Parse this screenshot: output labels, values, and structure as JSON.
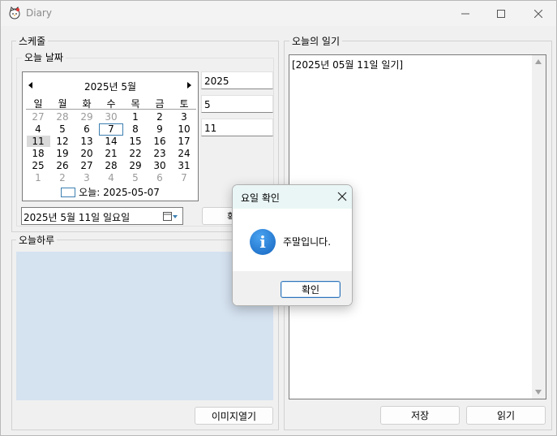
{
  "window": {
    "title": "Diary",
    "icon": "hello-kitty-app-icon"
  },
  "schedule": {
    "group_label": "스케줄",
    "today_date_label": "오늘 날짜",
    "calendar": {
      "month_title": "2025년 5월",
      "weekdays": [
        "일",
        "월",
        "화",
        "수",
        "목",
        "금",
        "토"
      ],
      "days": [
        {
          "d": "27",
          "other": true
        },
        {
          "d": "28",
          "other": true
        },
        {
          "d": "29",
          "other": true
        },
        {
          "d": "30",
          "other": true
        },
        {
          "d": "1"
        },
        {
          "d": "2"
        },
        {
          "d": "3"
        },
        {
          "d": "4"
        },
        {
          "d": "5"
        },
        {
          "d": "6"
        },
        {
          "d": "7",
          "today": true
        },
        {
          "d": "8"
        },
        {
          "d": "9"
        },
        {
          "d": "10"
        },
        {
          "d": "11",
          "selected": true
        },
        {
          "d": "12"
        },
        {
          "d": "13"
        },
        {
          "d": "14"
        },
        {
          "d": "15"
        },
        {
          "d": "16"
        },
        {
          "d": "17"
        },
        {
          "d": "18"
        },
        {
          "d": "19"
        },
        {
          "d": "20"
        },
        {
          "d": "21"
        },
        {
          "d": "22"
        },
        {
          "d": "23"
        },
        {
          "d": "24"
        },
        {
          "d": "25"
        },
        {
          "d": "26"
        },
        {
          "d": "27"
        },
        {
          "d": "28"
        },
        {
          "d": "29"
        },
        {
          "d": "30"
        },
        {
          "d": "31"
        },
        {
          "d": "1",
          "other": true
        },
        {
          "d": "2",
          "other": true
        },
        {
          "d": "3",
          "other": true
        },
        {
          "d": "4",
          "other": true
        },
        {
          "d": "5",
          "other": true
        },
        {
          "d": "6",
          "other": true
        },
        {
          "d": "7",
          "other": true
        }
      ],
      "today_text": "오늘: 2025-05-07"
    },
    "year_value": "2025",
    "month_value": "5",
    "day_value": "11",
    "date_picker_value": "2025년   5월 11일 일요일",
    "confirm_button_partial": "확"
  },
  "today_panel": {
    "group_label": "오늘하루",
    "open_image_button": "이미지열기"
  },
  "diary": {
    "group_label": "오늘의 일기",
    "content": "[2025년 05월 11일 일기]",
    "save_button": "저장",
    "read_button": "읽기"
  },
  "dialog": {
    "title": "요일 확인",
    "message": "주말입니다.",
    "ok_button": "확인",
    "icon": "info-icon"
  },
  "colors": {
    "image_panel_bg": "#d5e2f0",
    "dialog_title_bg": "#eaf6f6",
    "accent": "#3c7fb1"
  }
}
